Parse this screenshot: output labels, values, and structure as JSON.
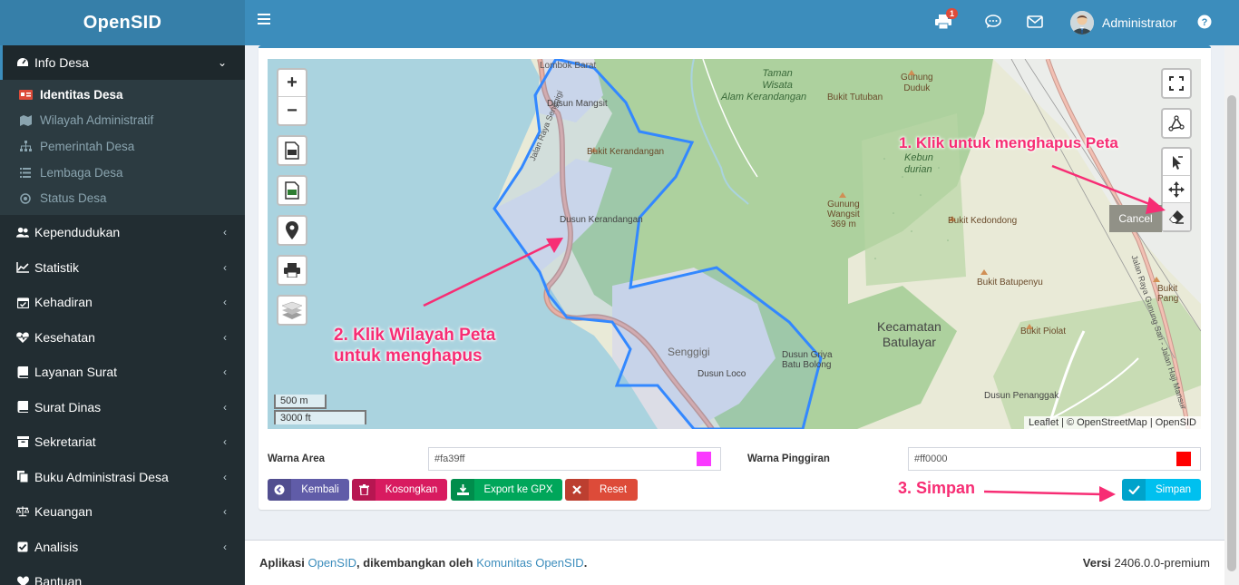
{
  "app": {
    "title": "OpenSID"
  },
  "sidebar": {
    "items": [
      {
        "label": "Info Desa",
        "icon": "dashboard-icon",
        "active": true
      },
      {
        "label": "Kependudukan",
        "icon": "users-icon"
      },
      {
        "label": "Statistik",
        "icon": "line-chart-icon"
      },
      {
        "label": "Kehadiran",
        "icon": "calendar-check-icon"
      },
      {
        "label": "Kesehatan",
        "icon": "heartbeat-icon"
      },
      {
        "label": "Layanan Surat",
        "icon": "book-icon"
      },
      {
        "label": "Surat Dinas",
        "icon": "book-icon"
      },
      {
        "label": "Sekretariat",
        "icon": "archive-icon"
      },
      {
        "label": "Buku Administrasi Desa",
        "icon": "copy-icon"
      },
      {
        "label": "Keuangan",
        "icon": "balance-scale-icon"
      },
      {
        "label": "Analisis",
        "icon": "check-square-icon"
      },
      {
        "label": "Bantuan",
        "icon": "heart-icon"
      }
    ],
    "submenu": [
      {
        "label": "Identitas Desa",
        "icon": "id-card-icon",
        "active": true
      },
      {
        "label": "Wilayah Administratif",
        "icon": "map-icon"
      },
      {
        "label": "Pemerintah Desa",
        "icon": "sitemap-icon"
      },
      {
        "label": "Lembaga Desa",
        "icon": "list-icon"
      },
      {
        "label": "Status Desa",
        "icon": "dot-circle-icon"
      }
    ]
  },
  "header": {
    "notification_count": "1",
    "user_name": "Administrator"
  },
  "map": {
    "labels": {
      "lombok_barat": "Lombok Barat",
      "taman_wisata_1": "Taman",
      "taman_wisata_2": "Wisata",
      "taman_wisata_3": "Alam Kerandangan",
      "gunung_duduk_1": "Gunung",
      "gunung_duduk_2": "Duduk",
      "bukit_tutuban": "Bukit Tutuban",
      "dusun_mangsit": "Dusun Mangsit",
      "jalan_raya_senggigi": "Jalan Raya Senggigi",
      "bukit_kerandangan": "Bukit Kerandangan",
      "kebun_durian_1": "Kebun",
      "kebun_durian_2": "durian",
      "gunung_wangsit_1": "Gunung",
      "gunung_wangsit_2": "Wangsit",
      "gunung_wangsit_3": "369 m",
      "dusun_kerandangan": "Dusun Kerandangan",
      "bukit_kedondong": "Bukit Kedondong",
      "bukit_batupenyu": "Bukit Batupenyu",
      "bukit_pang": "Bukit Pang",
      "senggigi": "Senggigi",
      "kecamatan_1": "Kecamatan",
      "kecamatan_2": "Batulayar",
      "dusun_griya_1": "Dusun Griya",
      "dusun_griya_2": "Batu Bolong",
      "dusun_loco": "Dusun Loco",
      "bukit_piolat": "Bukit Piolat",
      "dusun_penanggak": "Dusun Penanggak",
      "jalan_raya_gunung_sari": "Jalan Raya Gunung Sari - Jalan Haji Mansur"
    },
    "zoom_in": "+",
    "zoom_out": "−",
    "scale_metric": "500 m",
    "scale_imperial": "3000 ft",
    "attribution": "Leaflet | © OpenStreetMap | OpenSID",
    "cancel_tooltip": "Cancel",
    "polygon_color": "#3388ff",
    "water_color": "#aad3df",
    "forest_color": "#add19e"
  },
  "form": {
    "area_label": "Warna Area",
    "area_value": "#fa39ff",
    "area_color": "#fa39ff",
    "border_label": "Warna Pinggiran",
    "border_value": "#ff0000",
    "border_color": "#ff0000"
  },
  "buttons": {
    "back": "Kembali",
    "clear": "Kosongkan",
    "export": "Export ke GPX",
    "reset": "Reset",
    "save": "Simpan"
  },
  "annotations": {
    "step1": "1. Klik untuk menghapus Peta",
    "step2_line1": "2. Klik Wilayah Peta",
    "step2_line2": "untuk menghapus",
    "step3": "3. Simpan",
    "color": "#f72d74"
  },
  "footer": {
    "prefix": "Aplikasi",
    "app_link": "OpenSID",
    "middle": ", dikembangkan oleh",
    "community_link": "Komunitas OpenSID",
    "suffix": ".",
    "version_label": "Versi",
    "version_value": "2406.0.0-premium"
  }
}
